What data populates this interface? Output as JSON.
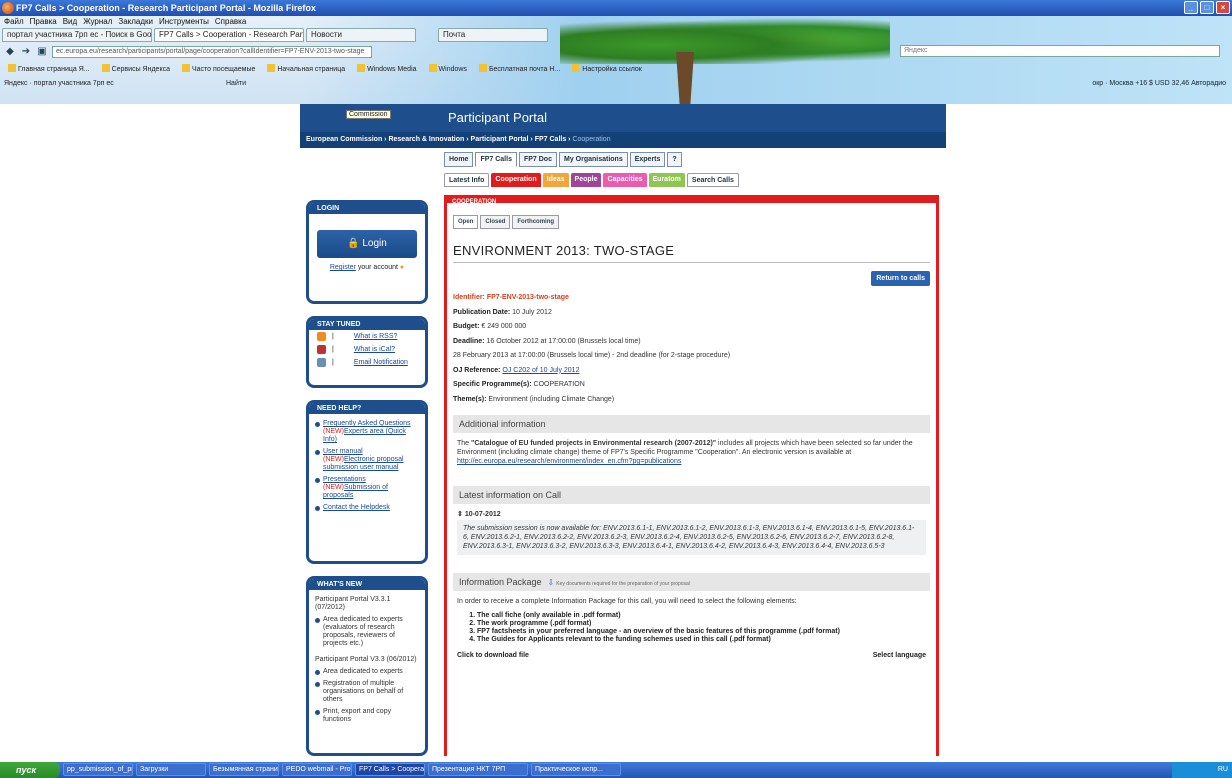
{
  "window": {
    "title": "FP7 Calls > Cooperation - Research Participant Portal - Mozilla Firefox"
  },
  "menu": [
    "Файл",
    "Правка",
    "Вид",
    "Журнал",
    "Закладки",
    "Инструменты",
    "Справка"
  ],
  "tabs": [
    {
      "label": "портал участника 7рп ес - Поиск в Goo..."
    },
    {
      "label": "FP7 Calls > Cooperation - Research Part..."
    },
    {
      "label": "Новости"
    },
    {
      "label": "Почта"
    }
  ],
  "url": "ec.europa.eu/research/participants/portal/page/cooperation?callIdentifier=FP7-ENV-2013-two-stage",
  "browser_search": "Яндекс",
  "bookmarks": [
    "Главная страница Я...",
    "Сервисы Яндекса",
    "Часто посещаемые",
    "Начальная страница",
    "Windows Media",
    "Windows",
    "Бесплатная почта H...",
    "Настройка ссылок"
  ],
  "yandex_bar": {
    "left": "Яндекс · портал участника 7рп ес",
    "find": "Найти",
    "right": "окр · Москва  +16  $ USD 32,46  Авторадио"
  },
  "tooltip": "Commission",
  "portal": {
    "header": "Participant Portal",
    "breadcrumb": "European Commission › Research & Innovation › Participant Portal › FP7 Calls › ",
    "breadcrumb_current": "Cooperation",
    "main_tabs": [
      "Home",
      "FP7 Calls",
      "FP7 Doc",
      "My Organisations",
      "Experts",
      "?"
    ],
    "sub_tabs": [
      {
        "label": "Latest Info",
        "color": "#ffffff"
      },
      {
        "label": "Cooperation",
        "color": "#e21c1c"
      },
      {
        "label": "Ideas",
        "color": "#f0a63a"
      },
      {
        "label": "People",
        "color": "#a0449a"
      },
      {
        "label": "Capacities",
        "color": "#ea5cb0"
      },
      {
        "label": "Euratom",
        "color": "#8ec651"
      },
      {
        "label": "Search Calls",
        "color": "#ffffff"
      }
    ],
    "section_label": "COOPERATION"
  },
  "sidebar": {
    "login": {
      "title": "LOGIN",
      "button": "Login",
      "register_link": "Register",
      "register_text": "your account"
    },
    "stay_tuned": {
      "title": "STAY TUNED",
      "items": [
        "What is RSS?",
        "What is iCal?",
        "Email Notification"
      ]
    },
    "need_help": {
      "title": "NEED HELP?",
      "items": [
        {
          "link": "Frequently Asked Questions",
          "new": "(NEW)",
          "extra": "Experts area (Quick Info)"
        },
        {
          "link": "User manual",
          "new": "(NEW)",
          "extra": "Electronic proposal submission user manual"
        },
        {
          "link": "Presentations",
          "new": "(NEW)",
          "extra": "Submission of proposals"
        },
        {
          "link": "Contact the Helpdesk",
          "new": "",
          "extra": ""
        }
      ]
    },
    "whats_new": {
      "title": "WHAT'S NEW",
      "v1": "Participant Portal V3.3.1 (07/2012)",
      "v1_items": [
        "Area dedicated to experts (evaluators of research proposals, reviewers of projects etc.)"
      ],
      "v2": "Participant Portal V3.3 (06/2012)",
      "v2_items": [
        "Area dedicated to experts",
        "Registration of multiple organisations on behalf of others",
        "Print, export and copy functions"
      ]
    }
  },
  "call": {
    "tabs": [
      "Open",
      "Closed",
      "Forthcoming"
    ],
    "title": "ENVIRONMENT 2013: TWO-STAGE",
    "return": "Return to calls",
    "identifier": "Identifier: FP7-ENV-2013-two-stage",
    "pub_label": "Publication Date:",
    "pub": "10 July 2012",
    "budget_label": "Budget:",
    "budget": "€ 249 000 000",
    "deadline_label": "Deadline:",
    "deadline": "16 October 2012 at 17:00:00 (Brussels local time)",
    "deadline2": "28 February 2013 at 17:00:00 (Brussels local time) - 2nd deadline (for 2-stage procedure)",
    "oj_label": "OJ Reference:",
    "oj": "OJ C202 of 10 July 2012",
    "prog_label": "Specific Programme(s):",
    "prog": "COOPERATION",
    "theme_label": "Theme(s):",
    "theme": "Environment (including Climate Change)",
    "add_info_hd": "Additional information",
    "add_info_pre": "The ",
    "add_info_bold": "\"Catalogue of EU funded projects in Environmental research (2007-2012)\"",
    "add_info_post": " includes all projects which have been selected so far under the Environment (including climate change) theme of FP7's Specific Programme \"Cooperation\". An electronic version is available at ",
    "add_info_link": "http://ec.europa.eu/research/environment/index_en.cfm?pg=publications",
    "latest_hd": "Latest information on Call",
    "latest_date": "10-07-2012",
    "latest_text": "The submission session is now available for: ENV.2013.6.1-1, ENV.2013.6.1-2, ENV.2013.6.1-3, ENV.2013.6.1-4, ENV.2013.6.1-5, ENV.2013.6.1-6, ENV.2013.6.2-1, ENV.2013.6.2-2, ENV.2013.6.2-3, ENV.2013.6.2-4, ENV.2013.6.2-5, ENV.2013.6.2-6, ENV.2013.6.2-7, ENV.2013.6.2-8, ENV.2013.6.3-1, ENV.2013.6.3-2, ENV.2013.6.3-3, ENV.2013.6.4-1, ENV.2013.6.4-2, ENV.2013.6.4-3, ENV.2013.6.4-4, ENV.2013.6.5-3",
    "pkg_hd": "Information Package",
    "pkg_note": "Key documents required for the preparation of your proposal",
    "pkg_intro": "In order to receive a complete Information Package for this call, you will need to select the following elements:",
    "pkg_items": [
      "The call fiche (only available in .pdf format)",
      "The work programme (.pdf format)",
      "FP7 factsheets in your preferred language - an overview of the basic features of this programme (.pdf format)",
      "The Guides for Applicants relevant to the funding schemes used in this call (.pdf format)"
    ],
    "download": "Click to download file",
    "select_lang": "Select language"
  },
  "taskbar": {
    "start": "пуск",
    "items": [
      "pp_submission_of_pr...",
      "Загрузки",
      "Безымянная страница...",
      "PEDO webmail - Profi...",
      "FP7 Calls > Cooperati...",
      "Презентация НКТ 7РП",
      "Практическое испр..."
    ],
    "tray": "RU"
  }
}
